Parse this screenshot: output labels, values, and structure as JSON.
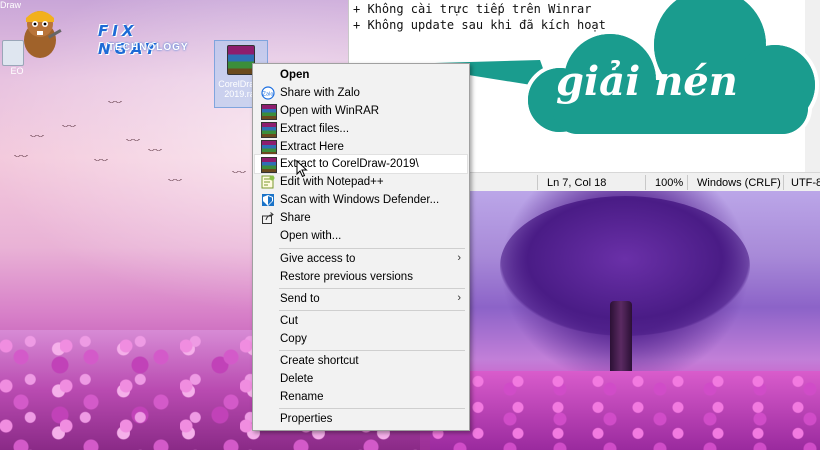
{
  "logo": {
    "brand": "FIX NGAY",
    "subtitle": "TECHNOLOGY"
  },
  "desktop": {
    "icons": [
      {
        "label": "Draw"
      },
      {
        "label": "EO"
      },
      {
        "label": "CorelDraw-2019.rar"
      }
    ]
  },
  "notepad": {
    "lines": [
      "+ Không cài trực tiếp trên Winrar",
      "+ Không update sau khi đã kích hoạt"
    ],
    "status": {
      "position": "Ln 7, Col 18",
      "zoom": "100%",
      "line_ending": "Windows (CRLF)",
      "encoding": "UTF-8"
    }
  },
  "callout": {
    "text": "giải nén",
    "color": "#1a9c8e"
  },
  "context_menu": {
    "items": [
      {
        "label": "Open",
        "icon": "none"
      },
      {
        "label": "Share with Zalo",
        "icon": "zalo-icon"
      },
      {
        "label": "Open with WinRAR",
        "icon": "winrar-icon"
      },
      {
        "label": "Extract files...",
        "icon": "winrar-icon"
      },
      {
        "label": "Extract Here",
        "icon": "winrar-icon"
      },
      {
        "label": "Extract to CorelDraw-2019\\",
        "icon": "winrar-icon"
      },
      {
        "label": "Edit with Notepad++",
        "icon": "notepadpp-icon"
      },
      {
        "label": "Scan with Windows Defender...",
        "icon": "defender-icon"
      },
      {
        "label": "Share",
        "icon": "share-icon"
      },
      {
        "label": "Open with...",
        "icon": "none"
      },
      {
        "label": "Give access to",
        "icon": "none"
      },
      {
        "label": "Restore previous versions",
        "icon": "none"
      },
      {
        "label": "Send to",
        "icon": "none"
      },
      {
        "label": "Cut",
        "icon": "none"
      },
      {
        "label": "Copy",
        "icon": "none"
      },
      {
        "label": "Create shortcut",
        "icon": "none"
      },
      {
        "label": "Delete",
        "icon": "none"
      },
      {
        "label": "Rename",
        "icon": "none"
      },
      {
        "label": "Properties",
        "icon": "none"
      }
    ],
    "highlighted": "Extract to CorelDraw-2019\\",
    "submenu_arrow": "›"
  }
}
